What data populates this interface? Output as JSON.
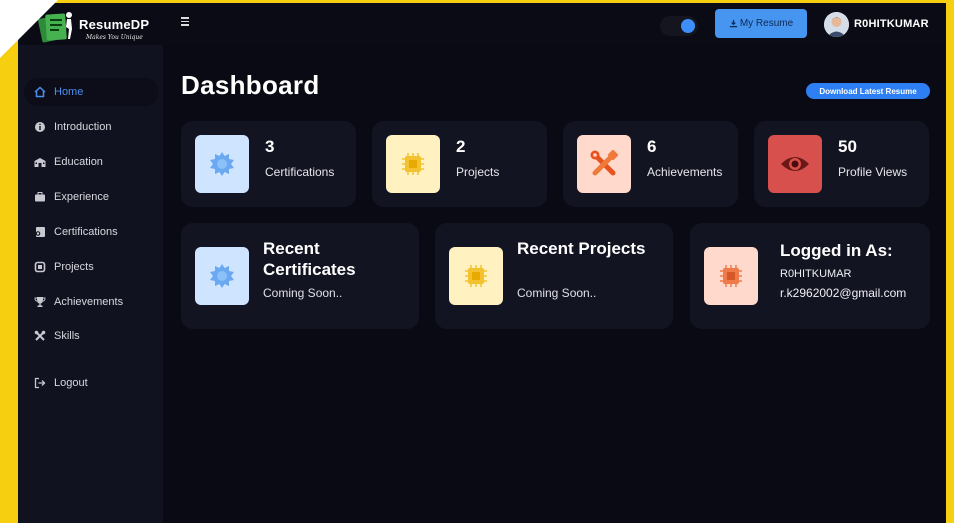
{
  "brand": {
    "name": "ResumeDP",
    "tagline": "Makes You Unique"
  },
  "header": {
    "my_resume_label": "My Resume",
    "user_name": "R0HITKUMAR",
    "theme_toggle_on": true
  },
  "sidebar": {
    "items": [
      {
        "label": "Home",
        "icon": "home-icon",
        "active": true
      },
      {
        "label": "Introduction",
        "icon": "info-icon",
        "active": false
      },
      {
        "label": "Education",
        "icon": "school-icon",
        "active": false
      },
      {
        "label": "Experience",
        "icon": "briefcase-icon",
        "active": false
      },
      {
        "label": "Certifications",
        "icon": "certificate-icon",
        "active": false
      },
      {
        "label": "Projects",
        "icon": "project-icon",
        "active": false
      },
      {
        "label": "Achievements",
        "icon": "trophy-icon",
        "active": false
      },
      {
        "label": "Skills",
        "icon": "tools-icon",
        "active": false
      }
    ],
    "logout_label": "Logout"
  },
  "dashboard": {
    "title": "Dashboard",
    "download_label": "Download Latest Resume",
    "stats": [
      {
        "value": "3",
        "label": "Certifications",
        "icon": "gear-icon"
      },
      {
        "value": "2",
        "label": "Projects",
        "icon": "chip-icon"
      },
      {
        "value": "6",
        "label": "Achievements",
        "icon": "tools-icon"
      },
      {
        "value": "50",
        "label": "Profile Views",
        "icon": "eye-icon"
      }
    ],
    "recent_certificates": {
      "title": "Recent Certificates",
      "status": "Coming Soon.."
    },
    "recent_projects": {
      "title": "Recent Projects",
      "status": "Coming Soon.."
    },
    "logged_in": {
      "title": "Logged in As:",
      "username": "R0HITKUMAR",
      "email": "r.k2962002@gmail.com"
    }
  },
  "colors": {
    "accent": "#2f7ff4",
    "background": "#0a0a14",
    "card": "#131422",
    "sidebar": "#111220",
    "frame": "#f5cf10"
  }
}
